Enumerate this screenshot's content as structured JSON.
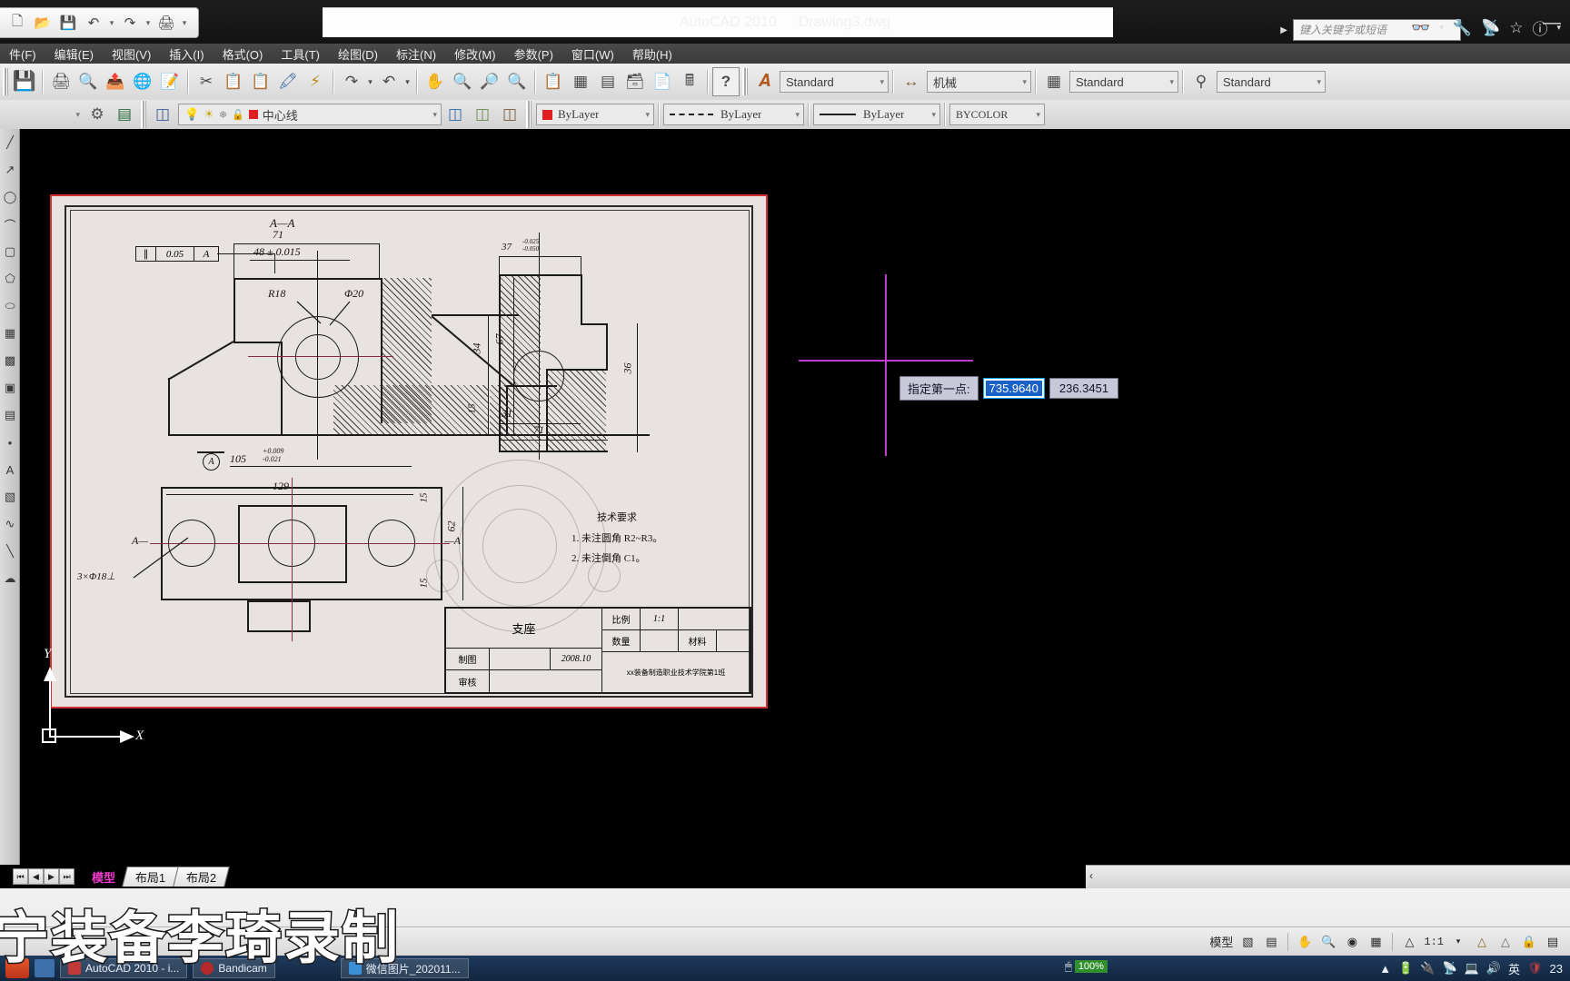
{
  "titlebar": {
    "app_title": "AutoCAD 2010",
    "document_title": "Drawing3.dwg",
    "quick_access": [
      {
        "name": "new-file",
        "glyph": "▢"
      },
      {
        "name": "open-file",
        "glyph": "Ὄ2"
      },
      {
        "name": "save-file",
        "glyph": "Ὃe"
      },
      {
        "name": "undo",
        "glyph": "↶"
      },
      {
        "name": "redo",
        "glyph": "↷"
      },
      {
        "name": "plot",
        "glyph": "⎙"
      }
    ],
    "search_placeholder": "键入关键字或短语",
    "minimize_label": "—",
    "help_icons": [
      "search-binoculars",
      "wrench",
      "satellite",
      "star",
      "question"
    ]
  },
  "menubar": {
    "items": [
      {
        "label": "件(F)"
      },
      {
        "label": "编辑(E)"
      },
      {
        "label": "视图(V)"
      },
      {
        "label": "插入(I)"
      },
      {
        "label": "格式(O)"
      },
      {
        "label": "工具(T)"
      },
      {
        "label": "绘图(D)"
      },
      {
        "label": "标注(N)"
      },
      {
        "label": "修改(M)"
      },
      {
        "label": "参数(P)"
      },
      {
        "label": "窗口(W)"
      },
      {
        "label": "帮助(H)"
      }
    ]
  },
  "toolbar_main": {
    "style_combo": "Standard",
    "dimstyle_combo": "机械",
    "table_combo": "Standard",
    "mleader_combo": "Standard"
  },
  "toolbar_layers": {
    "layer_name": "中心线",
    "color_combo": "ByLayer",
    "linetype_combo": "ByLayer",
    "lineweight_combo": "ByLayer",
    "plotstyle_combo": "BYCOLOR"
  },
  "dim_toolbar": {
    "dimstyle_combo": "机械",
    "close_label": "×",
    "icons": [
      "linear-dimension-icon",
      "aligned-dimension-icon",
      "arc-length-icon",
      "ordinate-dimension-icon",
      "radius-dimension-icon",
      "jogged-radius-icon",
      "diameter-dimension-icon",
      "angular-dimension-icon",
      "quick-dimension-icon",
      "baseline-dimension-icon",
      "continue-dimension-icon",
      "dimension-space-icon",
      "dimension-break-icon",
      "tolerance-icon",
      "center-mark-icon",
      "inspect-icon",
      "jogged-linear-icon",
      "dim-edit-icon",
      "dim-text-edit-icon",
      "dim-update-icon"
    ]
  },
  "mleader_toolbar": {
    "close_label": "×",
    "icons": [
      "multileader-icon",
      "mleader-add-icon",
      "mleader-remove-icon",
      "mleader-align-icon",
      "mleader-collect-icon"
    ]
  },
  "command_input": {
    "prompt": "指定第一点:",
    "x_value": "735.9640",
    "y_value": "236.3451",
    "highlight_color": "#1a62c8",
    "crosshair_color": "#c03ad0"
  },
  "ucs": {
    "x_label": "X",
    "y_label": "Y"
  },
  "layout_tabs": {
    "nav_first": "⏮",
    "nav_prev": "◀",
    "nav_next": "▶",
    "nav_last": "⏭",
    "tabs": [
      {
        "label": "模型",
        "active": true
      },
      {
        "label": "布局1",
        "active": false
      },
      {
        "label": "布局2",
        "active": false
      }
    ],
    "scroll_marker": "‹"
  },
  "status_bar": {
    "space_label": "模型",
    "scale_label": "1:1",
    "icons": [
      "model-space-icon",
      "layout-icon",
      "quick-view-layouts-icon",
      "pan-icon",
      "zoom-icon",
      "steering-wheel-icon",
      "showmotion-icon",
      "annotation-scale-icon",
      "annotation-visibility-icon",
      "annotation-auto-add-icon",
      "lock-icon"
    ]
  },
  "watermark": {
    "text": "宁装备李琦录制"
  },
  "taskbar": {
    "items": [
      {
        "label": "AutoCAD 2010 - i...",
        "color": "#c03a3a"
      },
      {
        "label": "Bandicam",
        "color": "#b42a2a"
      },
      {
        "label": "微信图片_202011...",
        "color": "#3b8fd4"
      }
    ],
    "zoom_percent": "100%",
    "tray_icons": [
      "chevron-up",
      "battery",
      "usb",
      "network",
      "volume",
      "ime",
      "shield"
    ],
    "ime_label": "英",
    "clock": "23"
  },
  "drawing": {
    "section_label": "A—A",
    "gdt_symbol": "∥",
    "gdt_tolerance": "0.05",
    "gdt_datum": "A",
    "dim_71_top": "71",
    "dim_48": "48 ± 0.015",
    "dim_R18": "R18",
    "dim_phi20": "Φ20",
    "dim_34": "34",
    "dim_67": "67",
    "dim_15a": "15",
    "dim_105": "105",
    "dim_105_upper": "+0.009",
    "dim_105_lower": "-0.021",
    "dim_129": "129",
    "datum_A_circle": "A",
    "dim_37": "37",
    "dim_37_upper": "-0.025",
    "dim_37_lower": "-0.050",
    "dim_36": "36",
    "dim_31": "31",
    "dim_71_right": "71",
    "dim_62": "62",
    "dim_15b": "15",
    "dim_15c": "15",
    "hole_note": "3×Φ18⊥",
    "section_left": "A—",
    "section_right": "—A",
    "tech_title": "技术要求",
    "tech_note_1": "1. 未注圆角 R2~R3。",
    "tech_note_2": "2. 未注倒角 C1。",
    "title_block": {
      "part_name": "支座",
      "scale_label": "比例",
      "scale_value": "1:1",
      "qty_label": "数量",
      "material_label": "材料",
      "drawn_label": "制图",
      "checked_label": "审核",
      "date": "2008.10",
      "org": "xx装备制造职业技术学院第1班"
    }
  }
}
